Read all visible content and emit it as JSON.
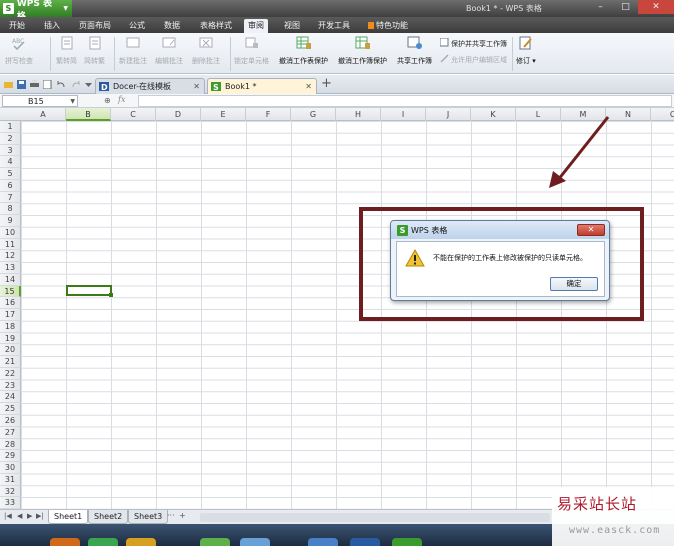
{
  "app": {
    "name": "WPS 表格",
    "logo_letter": "S",
    "window_title": "Book1 * - WPS 表格"
  },
  "menu": {
    "tabs": [
      "开始",
      "插入",
      "页面布局",
      "公式",
      "数据",
      "表格样式",
      "审阅",
      "视图",
      "开发工具",
      "特色功能"
    ],
    "active": "审阅"
  },
  "ribbon": {
    "spell_check": "拼写检查",
    "trad_to_simp": "繁转简",
    "simp_to_trad": "简转繁",
    "new_comment": "新建批注",
    "edit_comment": "编辑批注",
    "delete_comment": "删除批注",
    "lock_cell": "锁定单元格",
    "unprotect_sheet": "撤消工作表保护",
    "unprotect_book": "撤消工作簿保护",
    "share_book": "共享工作簿",
    "protect_share": "保护并共享工作簿",
    "allow_edit_ranges": "允许用户编辑区域",
    "track_changes": "修订"
  },
  "doc_tabs": [
    {
      "label": "Docer-在线模板",
      "active": false
    },
    {
      "label": "Book1 *",
      "active": true
    }
  ],
  "formula_bar": {
    "cell_ref": "B15",
    "fx": "fx",
    "value": ""
  },
  "columns": [
    "A",
    "B",
    "C",
    "D",
    "E",
    "F",
    "G",
    "H",
    "I",
    "J",
    "K",
    "L",
    "M",
    "N",
    "O"
  ],
  "selected_column": "B",
  "selected_row": 15,
  "rows": [
    "1",
    "2",
    "3",
    "4",
    "5",
    "6",
    "7",
    "8",
    "9",
    "10",
    "11",
    "12",
    "13",
    "14",
    "15",
    "16",
    "17",
    "18",
    "19",
    "20",
    "21",
    "22",
    "23",
    "24",
    "25",
    "26",
    "27",
    "28",
    "29",
    "30",
    "31",
    "32",
    "33"
  ],
  "sheets": {
    "tabs": [
      "Sheet1",
      "Sheet2",
      "Sheet3"
    ],
    "active": "Sheet1",
    "more": "···",
    "add": "+"
  },
  "dialog": {
    "title": "WPS 表格",
    "message": "不能在保护的工作表上修改被保护的只读单元格。",
    "ok_label": "确定"
  },
  "watermark": {
    "title": "易采站长站",
    "url": "www.easck.com"
  },
  "colors": {
    "annotation": "#6e1e1e",
    "brand_green": "#2f7d22",
    "title_bar": "#4a4a4a"
  }
}
